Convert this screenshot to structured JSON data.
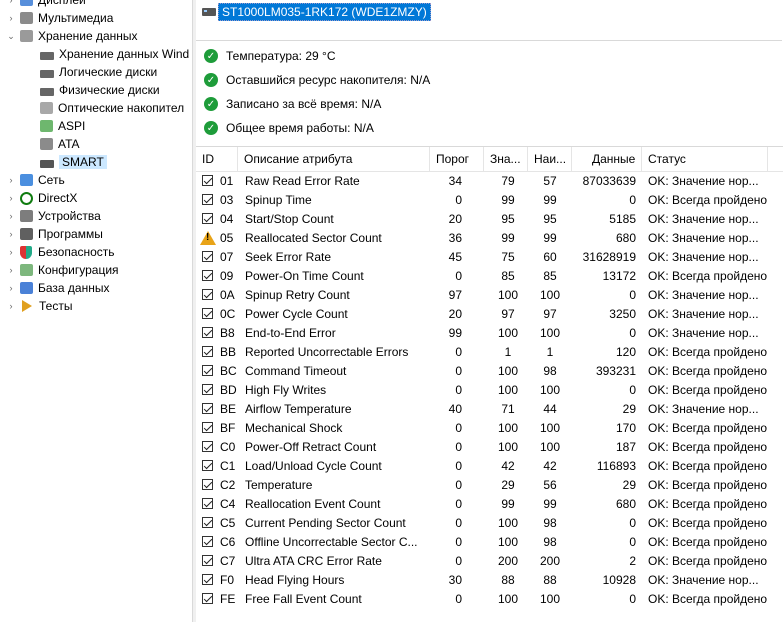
{
  "tree": {
    "items": [
      {
        "label": "Дисплей",
        "level": 0,
        "expander": "›",
        "icon": "monitor-icon"
      },
      {
        "label": "Мультимедиа",
        "level": 0,
        "expander": "›",
        "icon": "speaker-icon"
      },
      {
        "label": "Хранение данных",
        "level": 0,
        "expander": "⌄",
        "icon": "storage-icon"
      },
      {
        "label": "Хранение данных Wind",
        "level": 1,
        "expander": "",
        "icon": "disk-icon"
      },
      {
        "label": "Логические диски",
        "level": 1,
        "expander": "",
        "icon": "disk-icon"
      },
      {
        "label": "Физические диски",
        "level": 1,
        "expander": "",
        "icon": "disk-icon"
      },
      {
        "label": "Оптические накопител",
        "level": 1,
        "expander": "",
        "icon": "optical-icon"
      },
      {
        "label": "ASPI",
        "level": 1,
        "expander": "",
        "icon": "aspi-icon"
      },
      {
        "label": "ATA",
        "level": 1,
        "expander": "",
        "icon": "ata-icon"
      },
      {
        "label": "SMART",
        "level": 1,
        "expander": "",
        "icon": "drive-icon",
        "selected": true
      },
      {
        "label": "Сеть",
        "level": 0,
        "expander": "›",
        "icon": "network-icon"
      },
      {
        "label": "DirectX",
        "level": 0,
        "expander": "›",
        "icon": "xbox-icon"
      },
      {
        "label": "Устройства",
        "level": 0,
        "expander": "›",
        "icon": "devices-icon"
      },
      {
        "label": "Программы",
        "level": 0,
        "expander": "›",
        "icon": "programs-icon"
      },
      {
        "label": "Безопасность",
        "level": 0,
        "expander": "›",
        "icon": "shield-icon"
      },
      {
        "label": "Конфигурация",
        "level": 0,
        "expander": "›",
        "icon": "config-icon"
      },
      {
        "label": "База данных",
        "level": 0,
        "expander": "›",
        "icon": "database-icon"
      },
      {
        "label": "Тесты",
        "level": 0,
        "expander": "›",
        "icon": "tests-icon"
      }
    ]
  },
  "device": {
    "label": "ST1000LM035-1RK172 (WDE1ZMZY)"
  },
  "status": [
    {
      "text": "Температура: 29 °C"
    },
    {
      "text": "Оставшийся ресурс накопителя: N/A"
    },
    {
      "text": "Записано за всё время: N/A"
    },
    {
      "text": "Общее время работы: N/A"
    }
  ],
  "table": {
    "headers": [
      "ID",
      "Описание атрибута",
      "Порог",
      "Зна...",
      "Наи...",
      "Данные",
      "Статус"
    ],
    "rows": [
      {
        "id": "01",
        "desc": "Raw Read Error Rate",
        "thr": "34",
        "val": "79",
        "worst": "57",
        "data": "87033639",
        "status": "OK: Значение нор...",
        "warn": false
      },
      {
        "id": "03",
        "desc": "Spinup Time",
        "thr": "0",
        "val": "99",
        "worst": "99",
        "data": "0",
        "status": "OK: Всегда пройдено",
        "warn": false
      },
      {
        "id": "04",
        "desc": "Start/Stop Count",
        "thr": "20",
        "val": "95",
        "worst": "95",
        "data": "5185",
        "status": "OK: Значение нор...",
        "warn": false
      },
      {
        "id": "05",
        "desc": "Reallocated Sector Count",
        "thr": "36",
        "val": "99",
        "worst": "99",
        "data": "680",
        "status": "OK: Значение нор...",
        "warn": true
      },
      {
        "id": "07",
        "desc": "Seek Error Rate",
        "thr": "45",
        "val": "75",
        "worst": "60",
        "data": "31628919",
        "status": "OK: Значение нор...",
        "warn": false
      },
      {
        "id": "09",
        "desc": "Power-On Time Count",
        "thr": "0",
        "val": "85",
        "worst": "85",
        "data": "13172",
        "status": "OK: Всегда пройдено",
        "warn": false
      },
      {
        "id": "0A",
        "desc": "Spinup Retry Count",
        "thr": "97",
        "val": "100",
        "worst": "100",
        "data": "0",
        "status": "OK: Значение нор...",
        "warn": false
      },
      {
        "id": "0C",
        "desc": "Power Cycle Count",
        "thr": "20",
        "val": "97",
        "worst": "97",
        "data": "3250",
        "status": "OK: Значение нор...",
        "warn": false
      },
      {
        "id": "B8",
        "desc": "End-to-End Error",
        "thr": "99",
        "val": "100",
        "worst": "100",
        "data": "0",
        "status": "OK: Значение нор...",
        "warn": false
      },
      {
        "id": "BB",
        "desc": "Reported Uncorrectable Errors",
        "thr": "0",
        "val": "1",
        "worst": "1",
        "data": "120",
        "status": "OK: Всегда пройдено",
        "warn": false
      },
      {
        "id": "BC",
        "desc": "Command Timeout",
        "thr": "0",
        "val": "100",
        "worst": "98",
        "data": "393231",
        "status": "OK: Всегда пройдено",
        "warn": false
      },
      {
        "id": "BD",
        "desc": "High Fly Writes",
        "thr": "0",
        "val": "100",
        "worst": "100",
        "data": "0",
        "status": "OK: Всегда пройдено",
        "warn": false
      },
      {
        "id": "BE",
        "desc": "Airflow Temperature",
        "thr": "40",
        "val": "71",
        "worst": "44",
        "data": "29",
        "status": "OK: Значение нор...",
        "warn": false
      },
      {
        "id": "BF",
        "desc": "Mechanical Shock",
        "thr": "0",
        "val": "100",
        "worst": "100",
        "data": "170",
        "status": "OK: Всегда пройдено",
        "warn": false
      },
      {
        "id": "C0",
        "desc": "Power-Off Retract Count",
        "thr": "0",
        "val": "100",
        "worst": "100",
        "data": "187",
        "status": "OK: Всегда пройдено",
        "warn": false
      },
      {
        "id": "C1",
        "desc": "Load/Unload Cycle Count",
        "thr": "0",
        "val": "42",
        "worst": "42",
        "data": "116893",
        "status": "OK: Всегда пройдено",
        "warn": false
      },
      {
        "id": "C2",
        "desc": "Temperature",
        "thr": "0",
        "val": "29",
        "worst": "56",
        "data": "29",
        "status": "OK: Всегда пройдено",
        "warn": false
      },
      {
        "id": "C4",
        "desc": "Reallocation Event Count",
        "thr": "0",
        "val": "99",
        "worst": "99",
        "data": "680",
        "status": "OK: Всегда пройдено",
        "warn": false
      },
      {
        "id": "C5",
        "desc": "Current Pending Sector Count",
        "thr": "0",
        "val": "100",
        "worst": "98",
        "data": "0",
        "status": "OK: Всегда пройдено",
        "warn": false
      },
      {
        "id": "C6",
        "desc": "Offline Uncorrectable Sector C...",
        "thr": "0",
        "val": "100",
        "worst": "98",
        "data": "0",
        "status": "OK: Всегда пройдено",
        "warn": false
      },
      {
        "id": "C7",
        "desc": "Ultra ATA CRC Error Rate",
        "thr": "0",
        "val": "200",
        "worst": "200",
        "data": "2",
        "status": "OK: Всегда пройдено",
        "warn": false
      },
      {
        "id": "F0",
        "desc": "Head Flying Hours",
        "thr": "30",
        "val": "88",
        "worst": "88",
        "data": "10928",
        "status": "OK: Значение нор...",
        "warn": false
      },
      {
        "id": "FE",
        "desc": "Free Fall Event Count",
        "thr": "0",
        "val": "100",
        "worst": "100",
        "data": "0",
        "status": "OK: Всегда пройдено",
        "warn": false
      }
    ]
  }
}
